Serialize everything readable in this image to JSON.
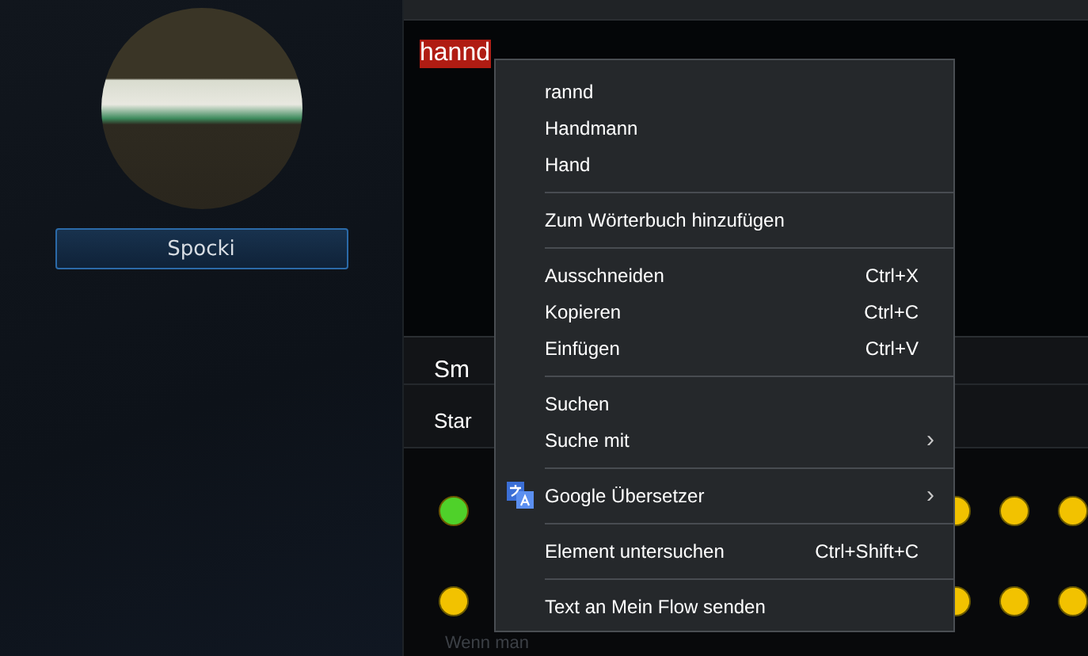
{
  "profile": {
    "name": "Spocki"
  },
  "editor": {
    "text": "hannd",
    "misspelled": true
  },
  "panel": {
    "heading": "Sm",
    "tab": "Star",
    "footer": "Wenn man"
  },
  "smileys": [
    [
      {
        "color": "#4fd12a"
      },
      {
        "color": "#f2c200"
      },
      {
        "color": "#f2c200"
      },
      {
        "color": "#f2c200"
      }
    ],
    [
      {
        "color": "#f2c200"
      },
      {
        "color": "#f2c200"
      },
      {
        "color": "#f2c200"
      },
      {
        "color": "#f2c200"
      }
    ]
  ],
  "context_menu": [
    {
      "kind": "item",
      "label": "rannd"
    },
    {
      "kind": "item",
      "label": "Handmann"
    },
    {
      "kind": "item",
      "label": "Hand"
    },
    {
      "kind": "separator"
    },
    {
      "kind": "item",
      "label": "Zum Wörterbuch hinzufügen"
    },
    {
      "kind": "separator"
    },
    {
      "kind": "item",
      "label": "Ausschneiden",
      "shortcut": "Ctrl+X"
    },
    {
      "kind": "item",
      "label": "Kopieren",
      "shortcut": "Ctrl+C"
    },
    {
      "kind": "item",
      "label": "Einfügen",
      "shortcut": "Ctrl+V"
    },
    {
      "kind": "separator"
    },
    {
      "kind": "item",
      "label": "Suchen"
    },
    {
      "kind": "item",
      "label": "Suche mit",
      "arrow": "›"
    },
    {
      "kind": "separator"
    },
    {
      "kind": "icon-item",
      "label": "Google Übersetzer",
      "arrow": "›"
    },
    {
      "kind": "separator"
    },
    {
      "kind": "item",
      "label": "Element untersuchen",
      "shortcut": "Ctrl+Shift+C"
    },
    {
      "kind": "separator"
    },
    {
      "kind": "item",
      "label": "Text an Mein Flow senden"
    }
  ]
}
